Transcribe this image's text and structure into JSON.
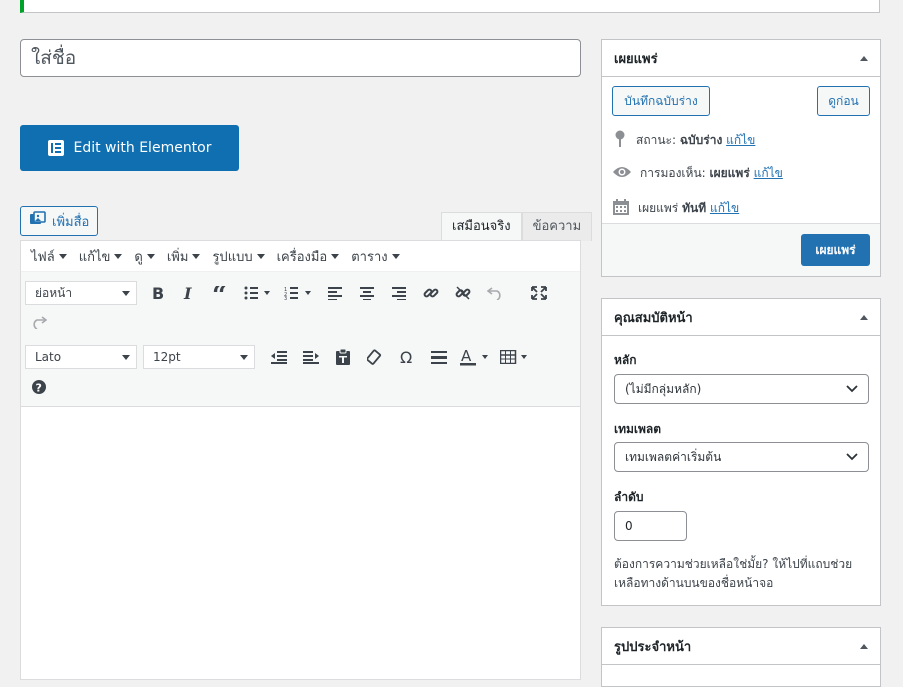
{
  "title_input": {
    "placeholder": "ใส่ชื่อ"
  },
  "elementor_button": {
    "label": "Edit with Elementor"
  },
  "add_media": {
    "label": "เพิ่มสื่อ"
  },
  "editor_tabs": {
    "visual": "เสมือนจริง",
    "text": "ข้อความ"
  },
  "menubar": [
    "ไฟล์",
    "แก้ไข",
    "ดู",
    "เพิ่ม",
    "รูปแบบ",
    "เครื่องมือ",
    "ตาราง"
  ],
  "toolbar": {
    "format_select": "ย่อหน้า",
    "font_family": "Lato",
    "font_size": "12pt"
  },
  "publish_box": {
    "title": "เผยแพร่",
    "save_draft": "บันทึกฉบับร่าง",
    "preview": "ดูก่อน",
    "status_label": "สถานะ:",
    "status_value": "ฉบับร่าง",
    "visibility_label": "การมองเห็น:",
    "visibility_value": "เผยแพร่",
    "publish_label": "เผยแพร่",
    "publish_value": "ทันที",
    "edit_link": "แก้ไข",
    "publish_button": "เผยแพร่"
  },
  "page_attributes": {
    "title": "คุณสมบัติหน้า",
    "parent_label": "หลัก",
    "parent_value": "(ไม่มีกลุ่มหลัก)",
    "template_label": "เทมเพลต",
    "template_value": "เทมเพลตค่าเริ่มต้น",
    "order_label": "ลำดับ",
    "order_value": "0",
    "help_text": "ต้องการความช่วยเหลือใช่มั้ย? ให้ไปที่แถบช่วยเหลือทางด้านบนของชื่อหน้าจอ"
  },
  "featured_image": {
    "title": "รูปประจำหน้า"
  },
  "colors": {
    "accent": "#2271b1",
    "elementor": "#0f6fb0",
    "notice": "#00a32a"
  }
}
